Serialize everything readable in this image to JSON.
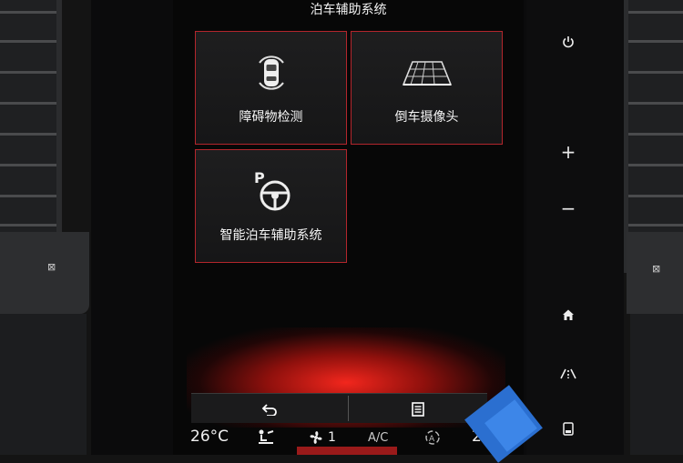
{
  "screen": {
    "title": "泊车辅助系统",
    "tiles": [
      {
        "label": "障碍物检测",
        "icon": "obstacle-detection-icon"
      },
      {
        "label": "倒车摄像头",
        "icon": "rear-camera-icon"
      },
      {
        "label": "智能泊车辅助系统",
        "icon": "park-assist-steering-icon",
        "icon_letter": "P"
      }
    ],
    "bottom_bar": {
      "back_icon": "back-arrow-icon",
      "menu_icon": "menu-list-icon"
    }
  },
  "climate": {
    "temperature": "26°C",
    "fan_speed": "1",
    "ac_label": "A/C",
    "right_partial": "2"
  },
  "side_controls": {
    "power_icon": "power-icon",
    "plus": "+",
    "minus": "−",
    "home_icon": "home-icon",
    "nav_icon": "road-navigation-icon",
    "phone_icon": "phone-screen-icon"
  },
  "colors": {
    "accent_red": "#b3262c",
    "glow_red": "#ff281e",
    "screen_bg": "#070707"
  }
}
